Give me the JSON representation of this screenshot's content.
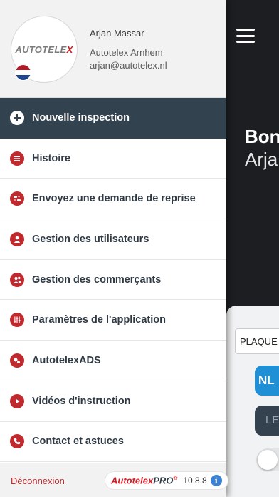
{
  "user": {
    "name": "Arjan Massar",
    "company": "Autotelex Arnhem",
    "email": "arjan@autotelex.nl",
    "logo_text": "AUTOTELE",
    "logo_x": "X",
    "flag": "netherlands-flag-icon"
  },
  "menu": {
    "items": [
      {
        "label": "Nouvelle inspection",
        "icon": "plus-icon",
        "active": true
      },
      {
        "label": "Histoire",
        "icon": "list-icon"
      },
      {
        "label": "Envoyez une demande de reprise",
        "icon": "car-swap-icon"
      },
      {
        "label": "Gestion des utilisateurs",
        "icon": "user-icon"
      },
      {
        "label": "Gestion des commerçants",
        "icon": "users-icon"
      },
      {
        "label": "Paramètres de l'application",
        "icon": "sliders-icon"
      },
      {
        "label": "AutotelexADS",
        "icon": "ads-icon"
      },
      {
        "label": "Vidéos d'instruction",
        "icon": "play-icon"
      },
      {
        "label": "Contact et astuces",
        "icon": "phone-icon"
      }
    ]
  },
  "footer": {
    "logout": "Déconnexion",
    "brand": "Autotelex",
    "brand_pro": "PRO",
    "registered": "®",
    "version": "10.8.8",
    "info": "i"
  },
  "background": {
    "greeting": "Bon",
    "greeting_name": "Arja",
    "plaque_label": "PLAQUE D",
    "nl_button": "NL",
    "le_button": "LE"
  },
  "colors": {
    "accent_red": "#c0292e",
    "active_bg": "#33424f",
    "nl_blue": "#1f8fd6"
  }
}
